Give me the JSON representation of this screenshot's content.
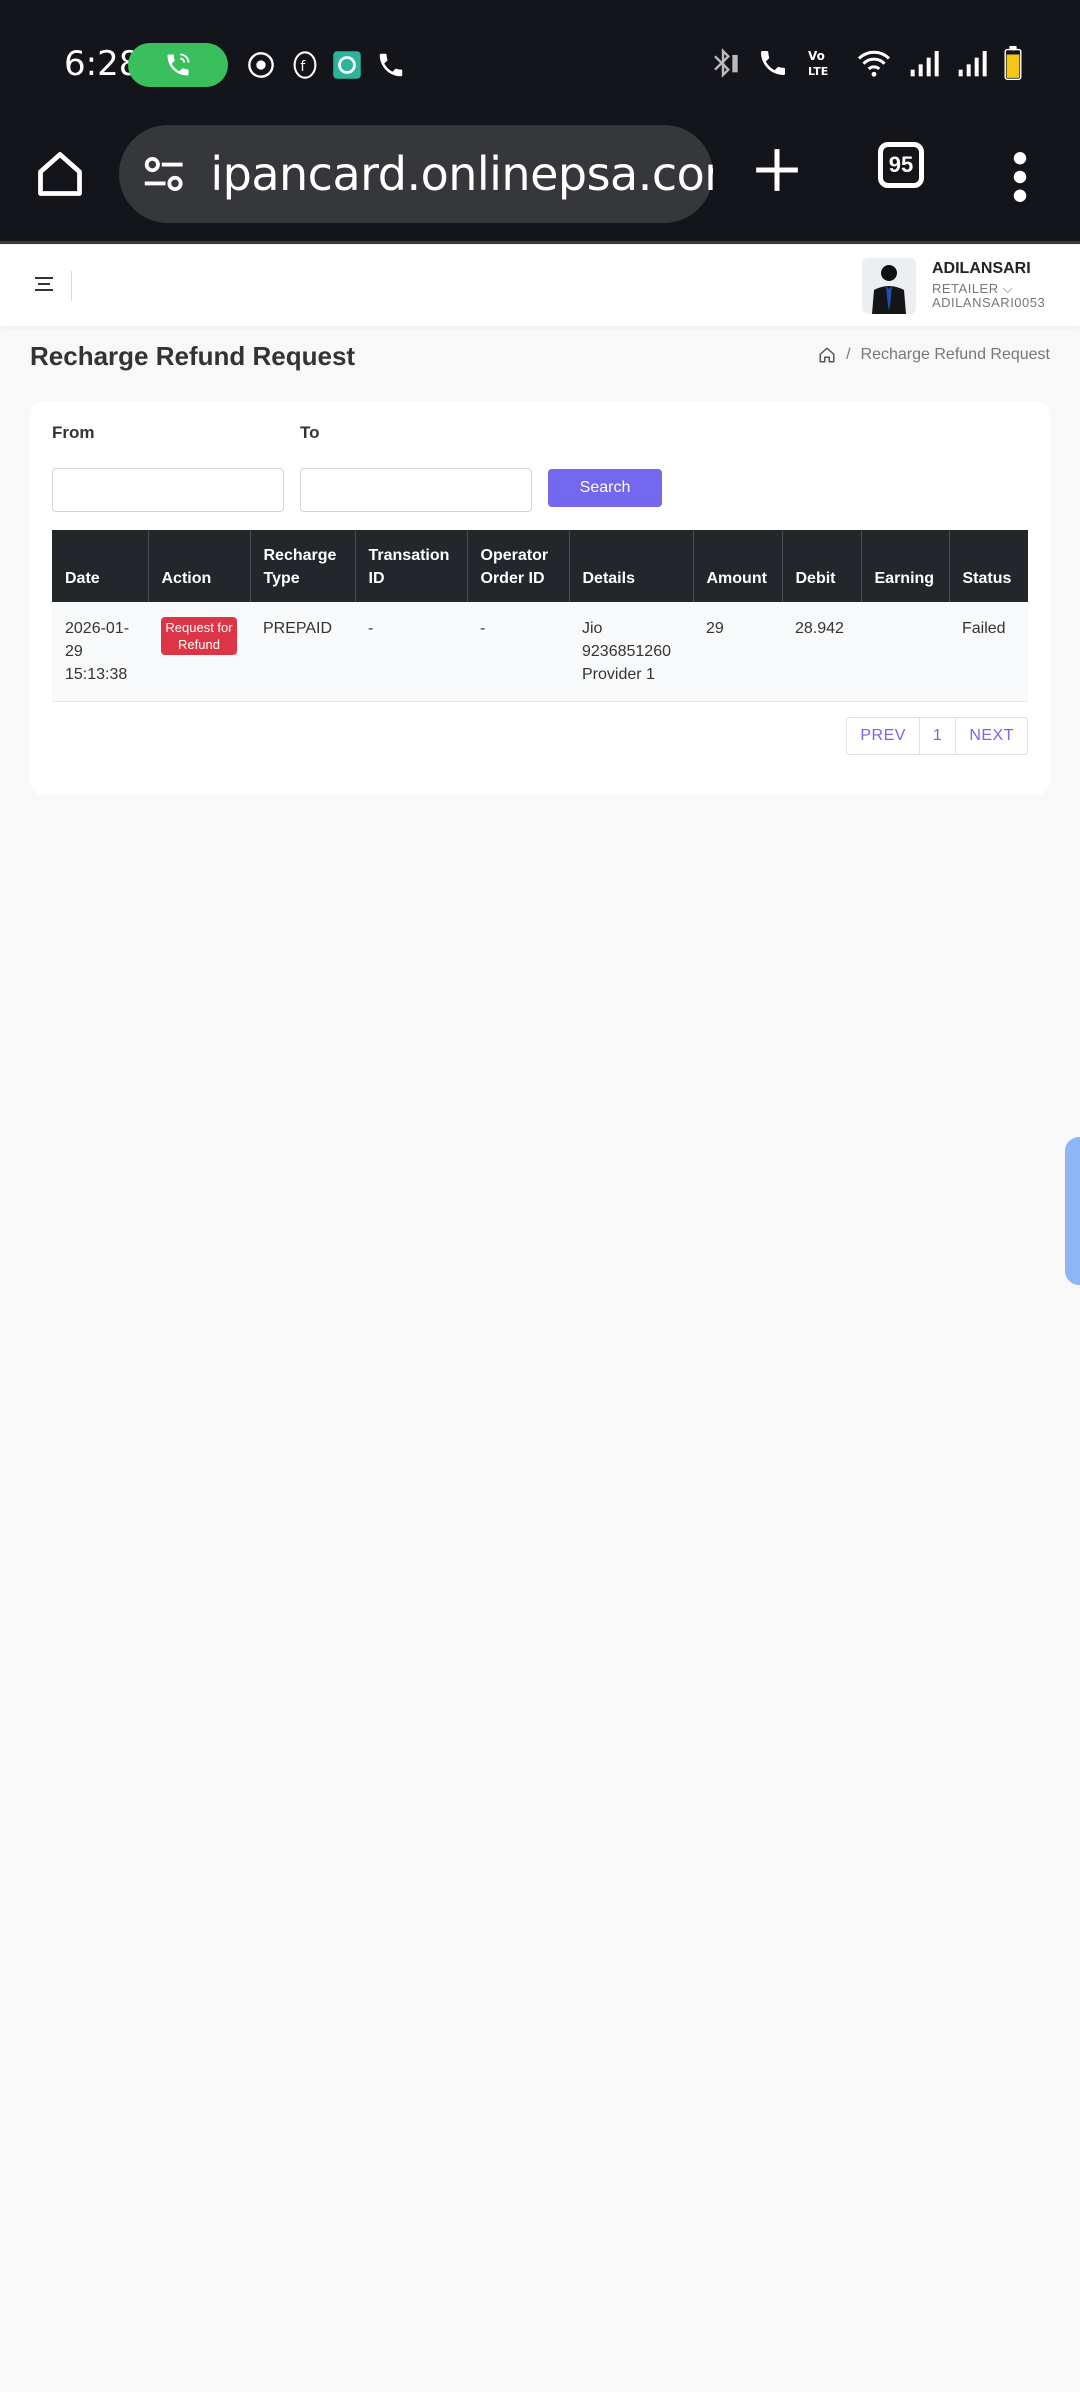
{
  "status_bar": {
    "time": "6:28"
  },
  "browser": {
    "url": "ipancard.onlinepsa.com",
    "tab_count": "95"
  },
  "header": {
    "user_name": "ADILANSARI",
    "user_role": "RETAILER ⌵",
    "user_id": "ADILANSARI0053"
  },
  "page": {
    "title": "Recharge Refund Request",
    "breadcrumb_current": "Recharge Refund Request",
    "breadcrumb_sep": "/"
  },
  "filters": {
    "from_label": "From",
    "to_label": "To",
    "from_value": "",
    "to_value": "",
    "search_label": "Search"
  },
  "table": {
    "headers": [
      "Date",
      "Action",
      "Recharge Type",
      "Transation ID",
      "Operator Order ID",
      "Details",
      "Amount",
      "Debit",
      "Earning",
      "Status"
    ],
    "rows": [
      {
        "date": "2026-01-29 15:13:38",
        "action": "Request for Refund",
        "recharge_type": "PREPAID",
        "transaction_id": "-",
        "operator_order_id": "-",
        "details": "Jio 9236851260 Provider 1",
        "amount": "29",
        "debit": "28.942",
        "earning": "",
        "status": "Failed"
      }
    ]
  },
  "pagination": {
    "prev": "PREV",
    "page": "1",
    "next": "NEXT"
  },
  "colors": {
    "primary": "#7367f0",
    "danger": "#dc3545",
    "table_header": "#23262b",
    "status_bar": "#14151b"
  }
}
